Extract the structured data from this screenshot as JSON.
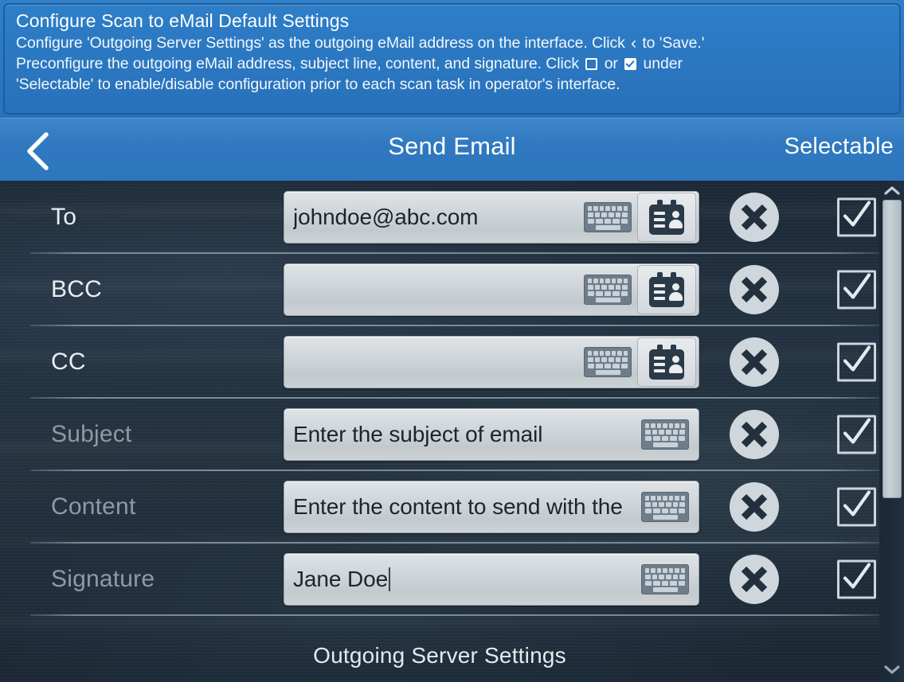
{
  "banner": {
    "title": "Configure Scan to eMail Default Settings",
    "line1_a": "Configure 'Outgoing Server Settings' as the outgoing eMail address on the interface. Click",
    "line1_b": "to 'Save.'",
    "line2_a": "Preconfigure the outgoing eMail address, subject line, content, and signature. Click",
    "line2_b": "or",
    "line2_c": "under",
    "line3": "'Selectable' to enable/disable configuration prior to each scan task in operator's interface.",
    "chevron_glyph": "‹",
    "accent_color": "#2872bb"
  },
  "header": {
    "back_label": "back-chevron",
    "title": "Send Email",
    "selectable_label": "Selectable"
  },
  "rows": [
    {
      "id": "to",
      "label": "To",
      "label_style": "bright",
      "value": "johndoe@abc.com",
      "placeholder": "",
      "has_caret": false,
      "has_address_book": true,
      "checked": true
    },
    {
      "id": "bcc",
      "label": "BCC",
      "label_style": "bright",
      "value": "",
      "placeholder": "",
      "has_caret": false,
      "has_address_book": true,
      "checked": true
    },
    {
      "id": "cc",
      "label": "CC",
      "label_style": "bright",
      "value": "",
      "placeholder": "",
      "has_caret": false,
      "has_address_book": true,
      "checked": true
    },
    {
      "id": "subject",
      "label": "Subject",
      "label_style": "dim",
      "value": "Enter the subject of email",
      "placeholder": "Enter the subject of email",
      "has_caret": false,
      "has_address_book": false,
      "checked": true
    },
    {
      "id": "content",
      "label": "Content",
      "label_style": "dim",
      "value": "Enter the content to send with the",
      "placeholder": "Enter the content to send with the",
      "has_caret": false,
      "has_address_book": false,
      "checked": true
    },
    {
      "id": "signature",
      "label": "Signature",
      "label_style": "dim",
      "value": "Jane Doe",
      "placeholder": "",
      "has_caret": true,
      "has_address_book": false,
      "checked": true
    }
  ],
  "footer": {
    "outgoing_server_settings": "Outgoing Server Settings"
  },
  "scrollbar": {
    "up_arrow": "chevron-up",
    "down_arrow": "chevron-down",
    "thumb_position_percent": 0,
    "thumb_size_percent": 62
  },
  "theme": {
    "banner_blue": "#2872bb",
    "titlebar_blue": "#2f78bf",
    "list_background": "#223141",
    "field_background": "#ced4d9",
    "label_bright": "#e9eef3",
    "label_dim": "#8e9aa6"
  }
}
